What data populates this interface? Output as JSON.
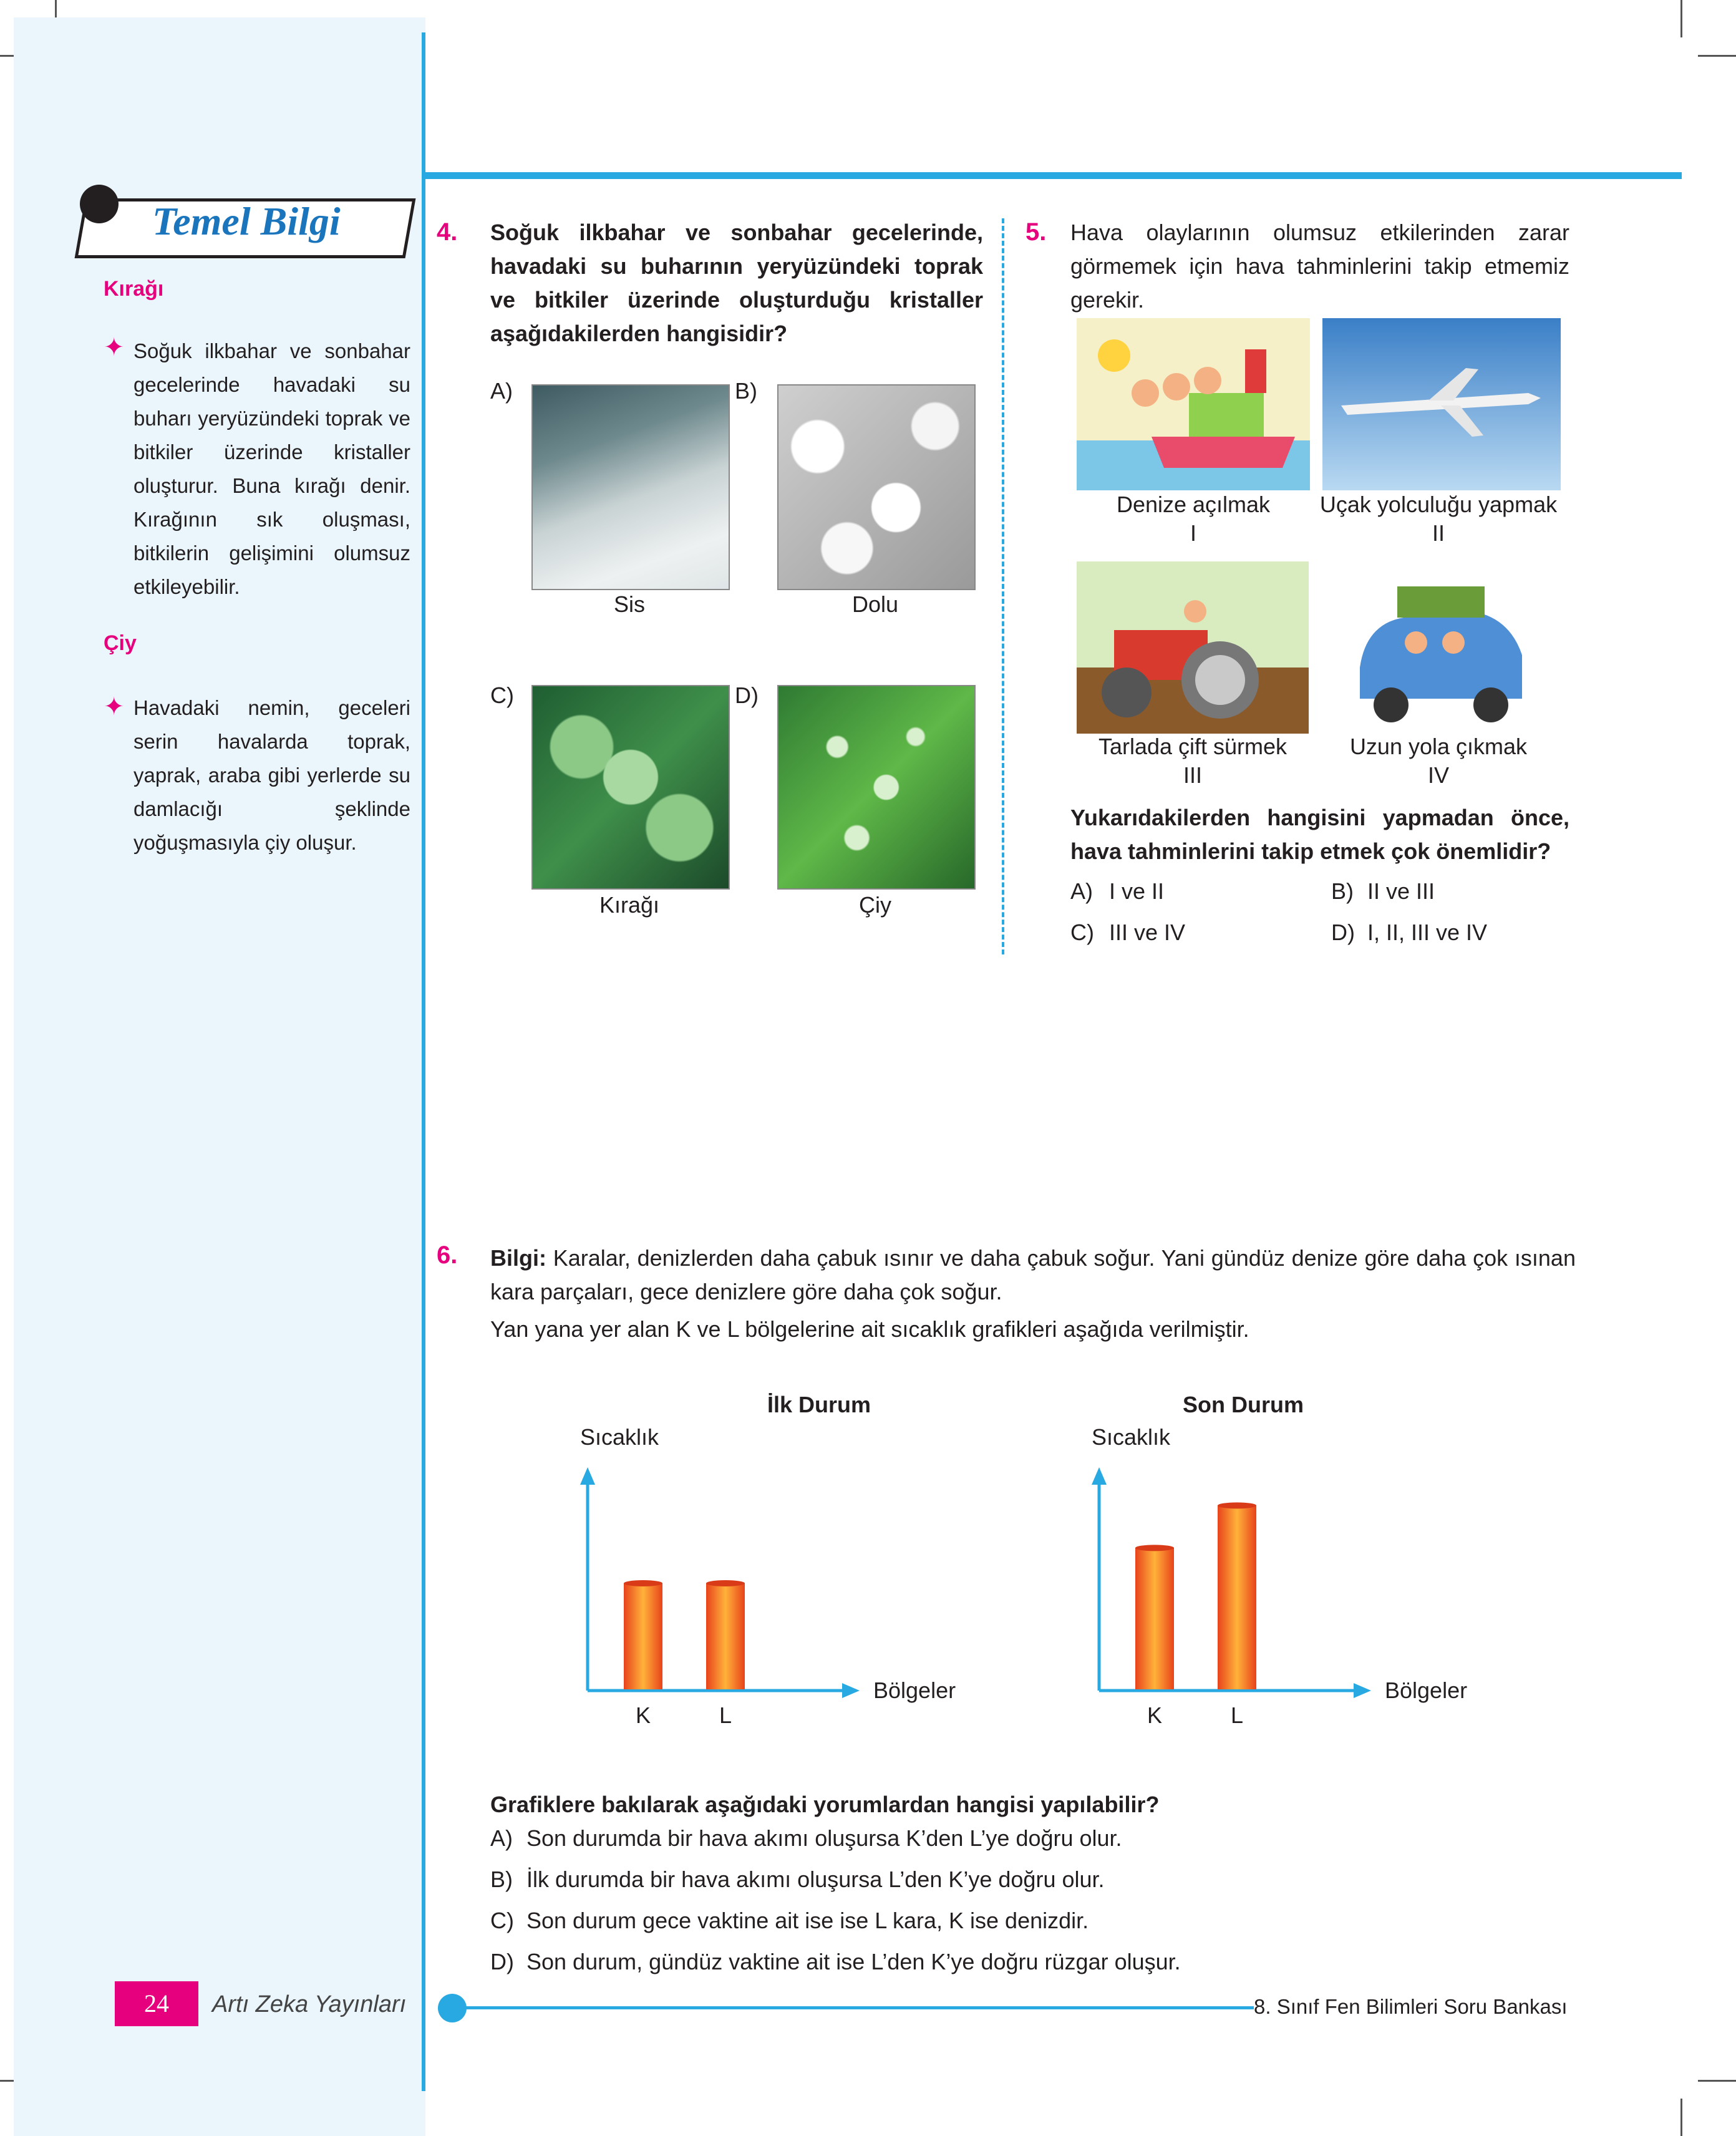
{
  "sidebar": {
    "title": "Temel Bilgi",
    "sections": [
      {
        "heading": "Kırağı",
        "text": "Soğuk ilkbahar ve sonbahar gecelerinde havadaki su buharı yeryüzündeki toprak ve bitkiler üzerinde kristaller oluşturur. Buna kırağı denir. Kırağının sık oluşması, bitkilerin gelişimini olumsuz etkileyebilir."
      },
      {
        "heading": "Çiy",
        "text": "Havadaki nemin, geceleri serin havalarda toprak, yaprak, araba gibi yerlerde su damlacığı şeklinde yoğuşmasıyla çiy oluşur."
      }
    ]
  },
  "q4": {
    "number": "4.",
    "text": "Soğuk ilkbahar ve sonbahar gecelerinde, havadaki su buharının yeryüzündeki toprak ve bitkiler üzerinde oluşturduğu kristaller aşağıdakilerden hangisidir?",
    "options": [
      {
        "letter": "A)",
        "caption": "Sis"
      },
      {
        "letter": "B)",
        "caption": "Dolu"
      },
      {
        "letter": "C)",
        "caption": "Kırağı"
      },
      {
        "letter": "D)",
        "caption": "Çiy"
      }
    ]
  },
  "q5": {
    "number": "5.",
    "text": "Hava olaylarının olumsuz etkilerinden zarar görmemek için hava tahminlerini takip etmemiz gerekir.",
    "items": [
      {
        "label": "Denize açılmak",
        "roman": "I"
      },
      {
        "label": "Uçak yolculuğu yapmak",
        "roman": "II"
      },
      {
        "label": "Tarlada çift sürmek",
        "roman": "III"
      },
      {
        "label": "Uzun yola çıkmak",
        "roman": "IV"
      }
    ],
    "question": "Yukarıdakilerden hangisini yapmadan önce, hava tahminlerini takip etmek çok önemlidir?",
    "answers": [
      {
        "letter": "A)",
        "text": "I ve II"
      },
      {
        "letter": "B)",
        "text": "II ve III"
      },
      {
        "letter": "C)",
        "text": "III ve IV"
      },
      {
        "letter": "D)",
        "text": "I, II, III ve IV"
      }
    ]
  },
  "q6": {
    "number": "6.",
    "info_label": "Bilgi:",
    "info_text": "Karalar, denizlerden daha çabuk ısınır ve daha çabuk soğur. Yani gündüz denize göre daha çok ısınan kara parçaları, gece denizlere göre daha çok soğur.",
    "info_text2": "Yan yana yer alan K ve L bölgelerine ait sıcaklık grafikleri aşağıda verilmiştir.",
    "question": "Grafiklere bakılarak aşağıdaki yorumlardan hangisi yapılabilir?",
    "answers": [
      {
        "letter": "A)",
        "text": "Son durumda bir hava akımı oluşursa K’den L’ye doğru olur."
      },
      {
        "letter": "B)",
        "text": "İlk durumda bir hava akımı oluşursa L’den K’ye doğru olur."
      },
      {
        "letter": "C)",
        "text": "Son durum gece vaktine ait ise ise L kara, K ise denizdir."
      },
      {
        "letter": "D)",
        "text": "Son durum, gündüz vaktine ait ise L’den K’ye doğru rüzgar oluşur."
      }
    ]
  },
  "chart_data": [
    {
      "type": "bar",
      "title": "İlk Durum",
      "ylabel": "Sıcaklık",
      "xlabel": "Bölgeler",
      "categories": [
        "K",
        "L"
      ],
      "values": [
        3,
        3
      ],
      "ylim": [
        0,
        6
      ]
    },
    {
      "type": "bar",
      "title": "Son Durum",
      "ylabel": "Sıcaklık",
      "xlabel": "Bölgeler",
      "categories": [
        "K",
        "L"
      ],
      "values": [
        4,
        5.2
      ],
      "ylim": [
        0,
        6
      ]
    }
  ],
  "footer": {
    "page_number": "24",
    "publisher": "Artı Zeka Yayınları",
    "book_title": "8. Sınıf Fen Bilimleri Soru Bankası"
  },
  "colors": {
    "accent": "#29a9e1",
    "magenta": "#e6007e",
    "bar": "#ee5a24"
  }
}
